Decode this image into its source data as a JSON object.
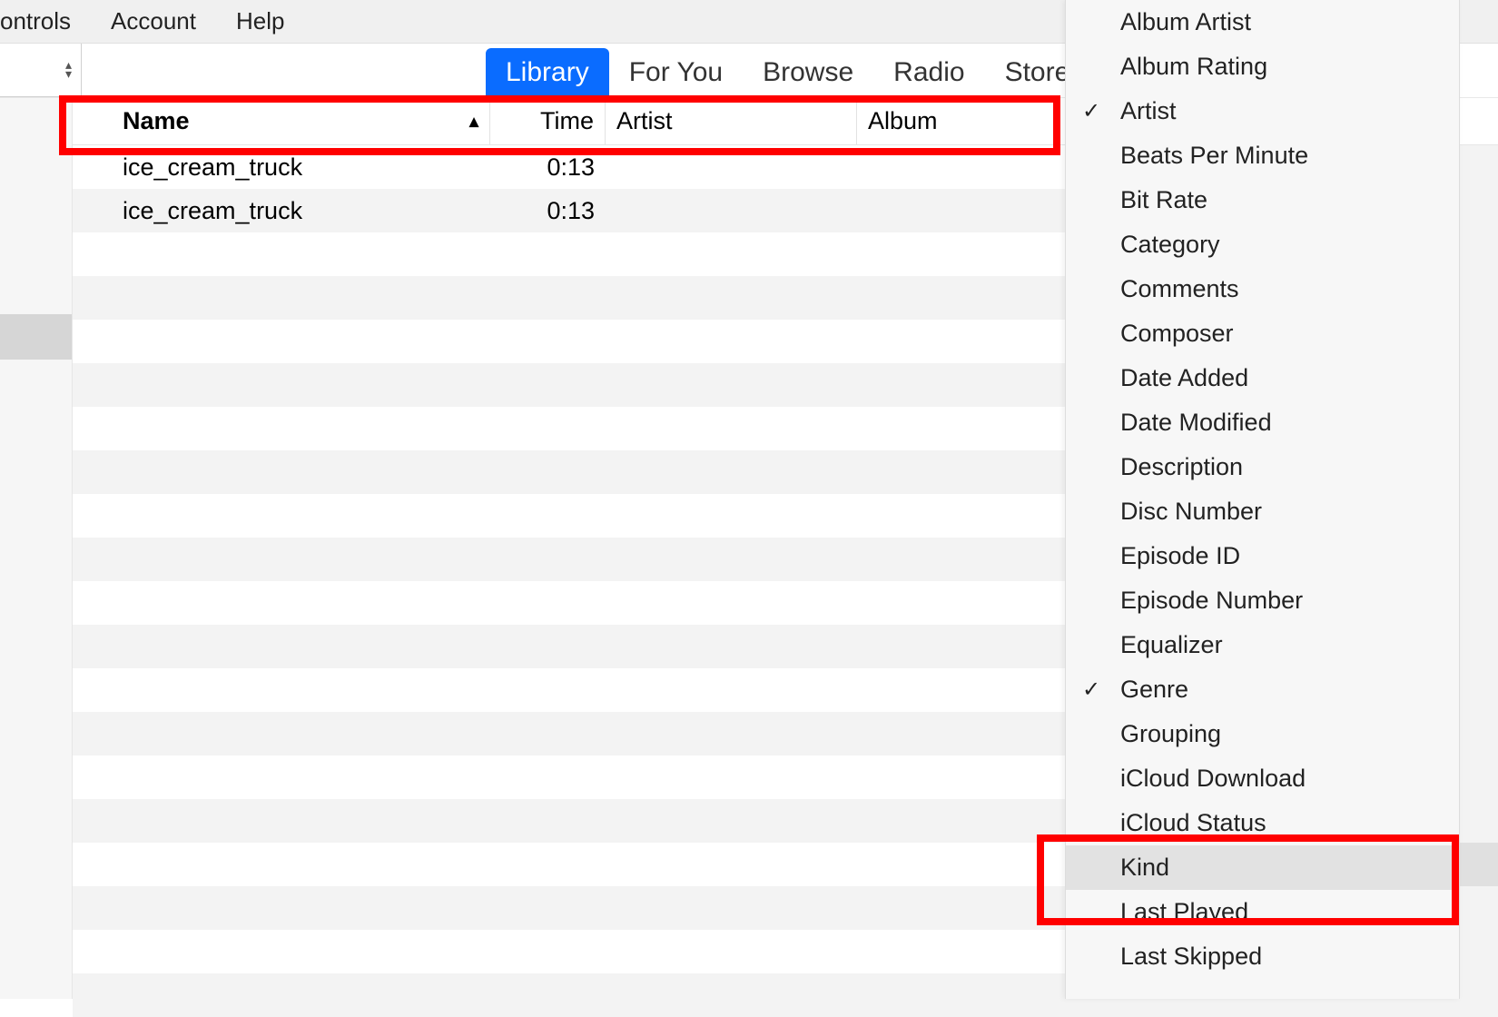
{
  "menubar": [
    {
      "label": "ontrols"
    },
    {
      "label": "Account"
    },
    {
      "label": "Help"
    }
  ],
  "tabs": [
    {
      "label": "Library",
      "active": true
    },
    {
      "label": "For You",
      "active": false
    },
    {
      "label": "Browse",
      "active": false
    },
    {
      "label": "Radio",
      "active": false
    },
    {
      "label": "Store",
      "active": false
    }
  ],
  "columns": {
    "name": "Name",
    "time": "Time",
    "artist": "Artist",
    "album": "Album"
  },
  "tracks": [
    {
      "name": "ice_cream_truck",
      "time": "0:13",
      "artist": "",
      "album": ""
    },
    {
      "name": "ice_cream_truck",
      "time": "0:13",
      "artist": "",
      "album": ""
    }
  ],
  "context_menu": [
    {
      "label": "Album Artist",
      "checked": false
    },
    {
      "label": "Album Rating",
      "checked": false
    },
    {
      "label": "Artist",
      "checked": true
    },
    {
      "label": "Beats Per Minute",
      "checked": false
    },
    {
      "label": "Bit Rate",
      "checked": false
    },
    {
      "label": "Category",
      "checked": false
    },
    {
      "label": "Comments",
      "checked": false
    },
    {
      "label": "Composer",
      "checked": false
    },
    {
      "label": "Date Added",
      "checked": false
    },
    {
      "label": "Date Modified",
      "checked": false
    },
    {
      "label": "Description",
      "checked": false
    },
    {
      "label": "Disc Number",
      "checked": false
    },
    {
      "label": "Episode ID",
      "checked": false
    },
    {
      "label": "Episode Number",
      "checked": false
    },
    {
      "label": "Equalizer",
      "checked": false
    },
    {
      "label": "Genre",
      "checked": true
    },
    {
      "label": "Grouping",
      "checked": false
    },
    {
      "label": "iCloud Download",
      "checked": false
    },
    {
      "label": "iCloud Status",
      "checked": false
    },
    {
      "label": "Kind",
      "checked": false,
      "hover": true
    },
    {
      "label": "Last Played",
      "checked": false
    },
    {
      "label": "Last Skipped",
      "checked": false
    }
  ],
  "icons": {
    "sort_up": "▴",
    "spinner_up": "▴",
    "spinner_down": "▾",
    "check": "✓"
  }
}
